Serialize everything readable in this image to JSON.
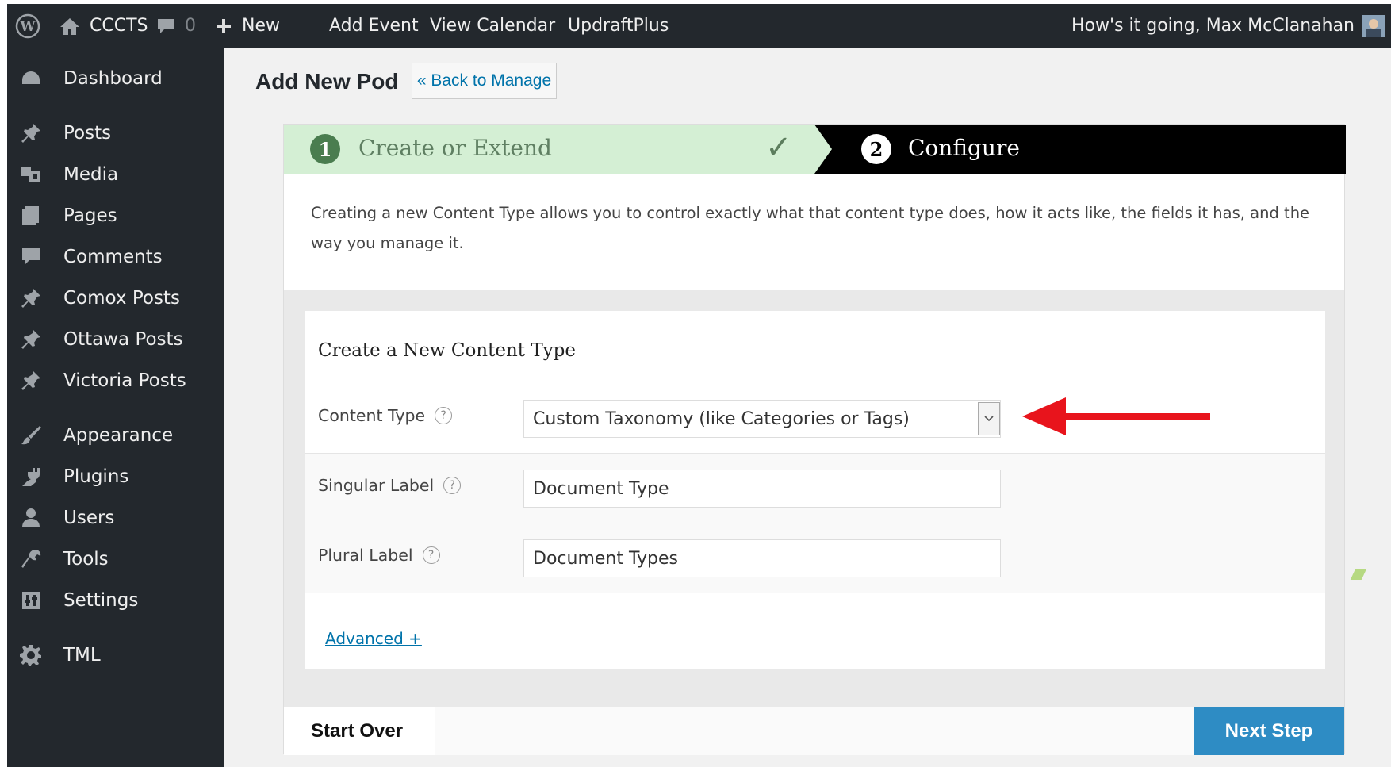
{
  "adminbar": {
    "site_name": "CCCTS",
    "comments_count": "0",
    "new_label": "New",
    "add_event": "Add Event",
    "view_calendar": "View Calendar",
    "updraftplus": "UpdraftPlus",
    "greeting": "How's it going, Max McClanahan"
  },
  "sidebar": {
    "items": [
      {
        "label": "Dashboard",
        "icon": "dashboard-icon"
      },
      {
        "label": "Posts",
        "icon": "pin-icon"
      },
      {
        "label": "Media",
        "icon": "media-icon"
      },
      {
        "label": "Pages",
        "icon": "pages-icon"
      },
      {
        "label": "Comments",
        "icon": "comment-icon"
      },
      {
        "label": "Comox Posts",
        "icon": "pin-icon"
      },
      {
        "label": "Ottawa Posts",
        "icon": "pin-icon"
      },
      {
        "label": "Victoria Posts",
        "icon": "pin-icon"
      },
      {
        "label": "Appearance",
        "icon": "brush-icon"
      },
      {
        "label": "Plugins",
        "icon": "plugin-icon"
      },
      {
        "label": "Users",
        "icon": "user-icon"
      },
      {
        "label": "Tools",
        "icon": "wrench-icon"
      },
      {
        "label": "Settings",
        "icon": "settings-icon"
      },
      {
        "label": "TML",
        "icon": "gear-icon"
      }
    ]
  },
  "page": {
    "title": "Add New Pod",
    "back_button": "« Back to Manage"
  },
  "wizard": {
    "step1_number": "1",
    "step1_label": "Create or Extend",
    "step1_check": "✓",
    "step2_number": "2",
    "step2_label": "Configure",
    "intro": "Creating a new Content Type allows you to control exactly what that content type does, how it acts like, the fields it has, and the way you manage it."
  },
  "form": {
    "heading": "Create a New Content Type",
    "content_type_label": "Content Type",
    "content_type_value": "Custom Taxonomy (like Categories or Tags)",
    "singular_label": "Singular Label",
    "singular_value": "Document Type",
    "plural_label": "Plural Label",
    "plural_value": "Document Types",
    "help_glyph": "?",
    "advanced_link": "Advanced +"
  },
  "footer": {
    "start_over": "Start Over",
    "next_step": "Next Step"
  },
  "colors": {
    "adminbar_bg": "#23282d",
    "step_done_bg": "#d4efd4",
    "step_active_bg": "#000000",
    "primary_button": "#2e8cc4",
    "annotation_arrow": "#e8141c"
  }
}
